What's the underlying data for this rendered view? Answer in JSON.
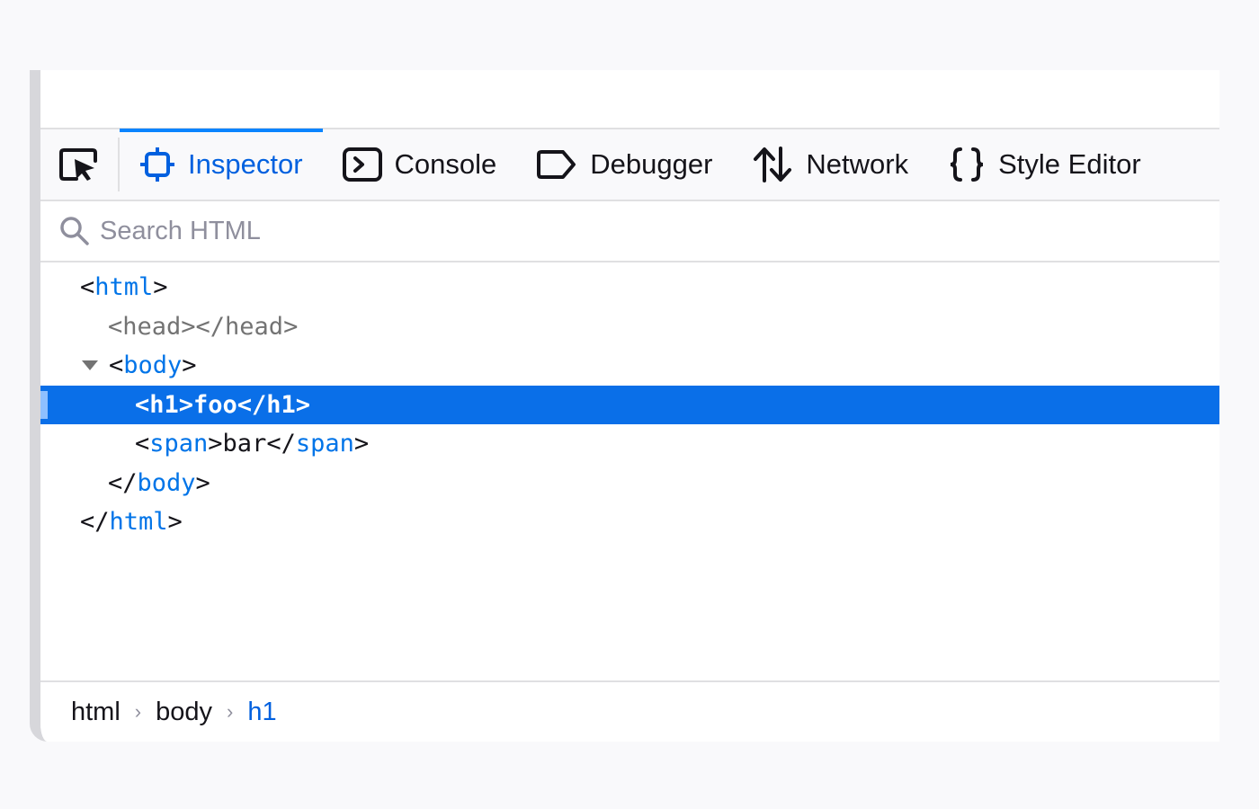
{
  "toolbar": {
    "tabs": [
      {
        "label": "Inspector",
        "icon": "inspector-icon",
        "selected": true
      },
      {
        "label": "Console",
        "icon": "console-icon",
        "selected": false
      },
      {
        "label": "Debugger",
        "icon": "debugger-icon",
        "selected": false
      },
      {
        "label": "Network",
        "icon": "network-icon",
        "selected": false
      },
      {
        "label": "Style Editor",
        "icon": "style-editor-icon",
        "selected": false
      }
    ]
  },
  "search": {
    "placeholder": "Search HTML",
    "value": ""
  },
  "tree": {
    "html_open": {
      "lt": "<",
      "name": "html",
      "gt": ">"
    },
    "head": {
      "text": "<head></head>"
    },
    "body_open": {
      "lt": "<",
      "name": "body",
      "gt": ">"
    },
    "h1": {
      "text": "<h1>foo</h1>"
    },
    "span": {
      "lt": "<",
      "name": "span",
      "mid": ">bar</",
      "name2": "span",
      "gt": ">"
    },
    "body_close": {
      "lt": "</",
      "name": "body",
      "gt": ">"
    },
    "html_close": {
      "lt": "</",
      "name": "html",
      "gt": ">"
    }
  },
  "breadcrumbs": {
    "items": [
      "html",
      "body",
      "h1"
    ],
    "separator": "›"
  },
  "colors": {
    "accent": "#0060df",
    "selection": "#0a6fe8",
    "tag": "#0074e8",
    "dim": "#737373"
  }
}
